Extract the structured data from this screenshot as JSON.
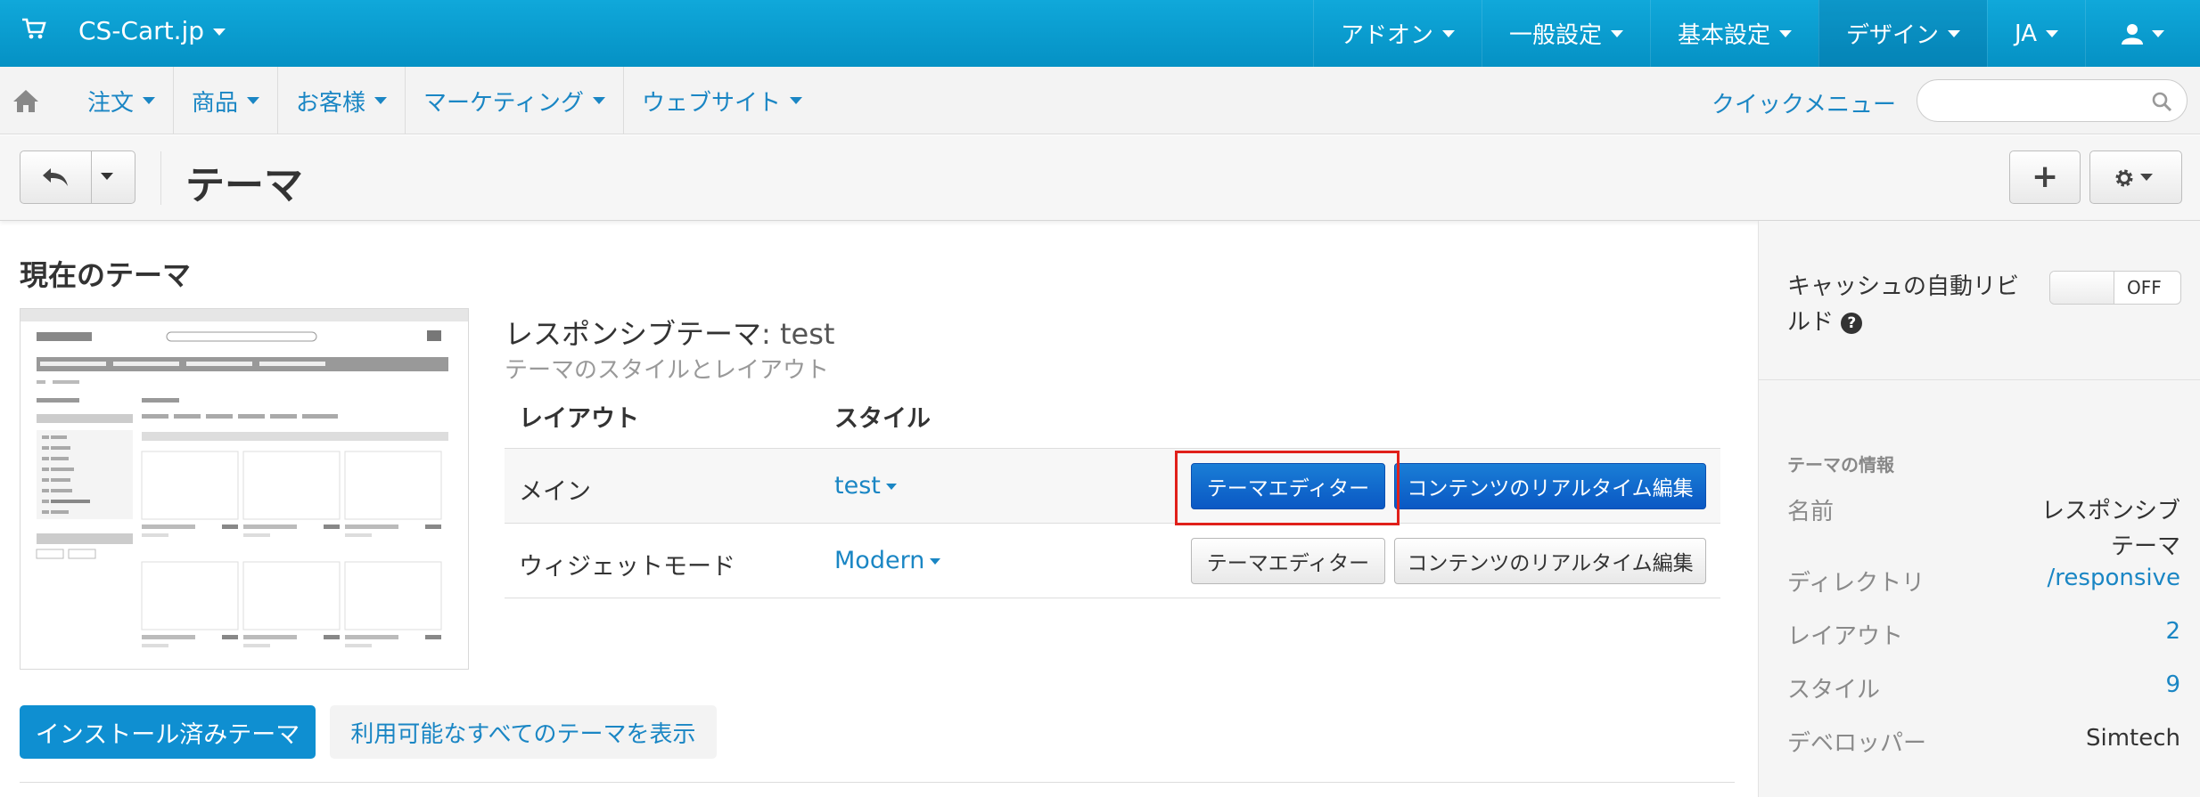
{
  "topbar": {
    "brand": "CS-Cart.jp",
    "menu": [
      "アドオン",
      "一般設定",
      "基本設定",
      "デザイン",
      "JA"
    ],
    "colors": {
      "bar": "#0a9fd6",
      "link": "#1a86c4",
      "primary": "#0a58c4",
      "highlight": "#e0201a"
    }
  },
  "nav": {
    "items": [
      "注文",
      "商品",
      "お客様",
      "マーケティング",
      "ウェブサイト"
    ],
    "quick_menu": "クイックメニュー",
    "search_placeholder": ""
  },
  "toolbar": {
    "title": "テーマ",
    "plus": "+"
  },
  "main": {
    "section_title": "現在のテーマ",
    "theme_name": "レスポンシブテーマ",
    "theme_suffix": ": test",
    "theme_description": "テーマのスタイルとレイアウト",
    "table": {
      "headers": [
        "レイアウト",
        "スタイル"
      ],
      "rows": [
        {
          "layout": "メイン",
          "style": "test",
          "editor_button": "テーマエディター",
          "realtime_button": "コンテンツのリアルタイム編集"
        },
        {
          "layout": "ウィジェットモード",
          "style": "Modern",
          "editor_button": "テーマエディター",
          "realtime_button": "コンテンツのリアルタイム編集"
        }
      ]
    },
    "tabs": {
      "installed": "インストール済みテーマ",
      "browse_all": "利用可能なすべてのテーマを表示"
    }
  },
  "sidebar": {
    "cache_label": "キャッシュの自動リビルド",
    "help": "?",
    "toggle_state": "OFF",
    "info_heading": "テーマの情報",
    "info": [
      {
        "key": "名前",
        "value": "レスポンシブテーマ"
      },
      {
        "key": "ディレクトリ",
        "value": "/responsive"
      },
      {
        "key": "レイアウト",
        "value": "2"
      },
      {
        "key": "スタイル",
        "value": "9"
      },
      {
        "key": "デベロッパー",
        "value": "Simtech"
      }
    ]
  }
}
